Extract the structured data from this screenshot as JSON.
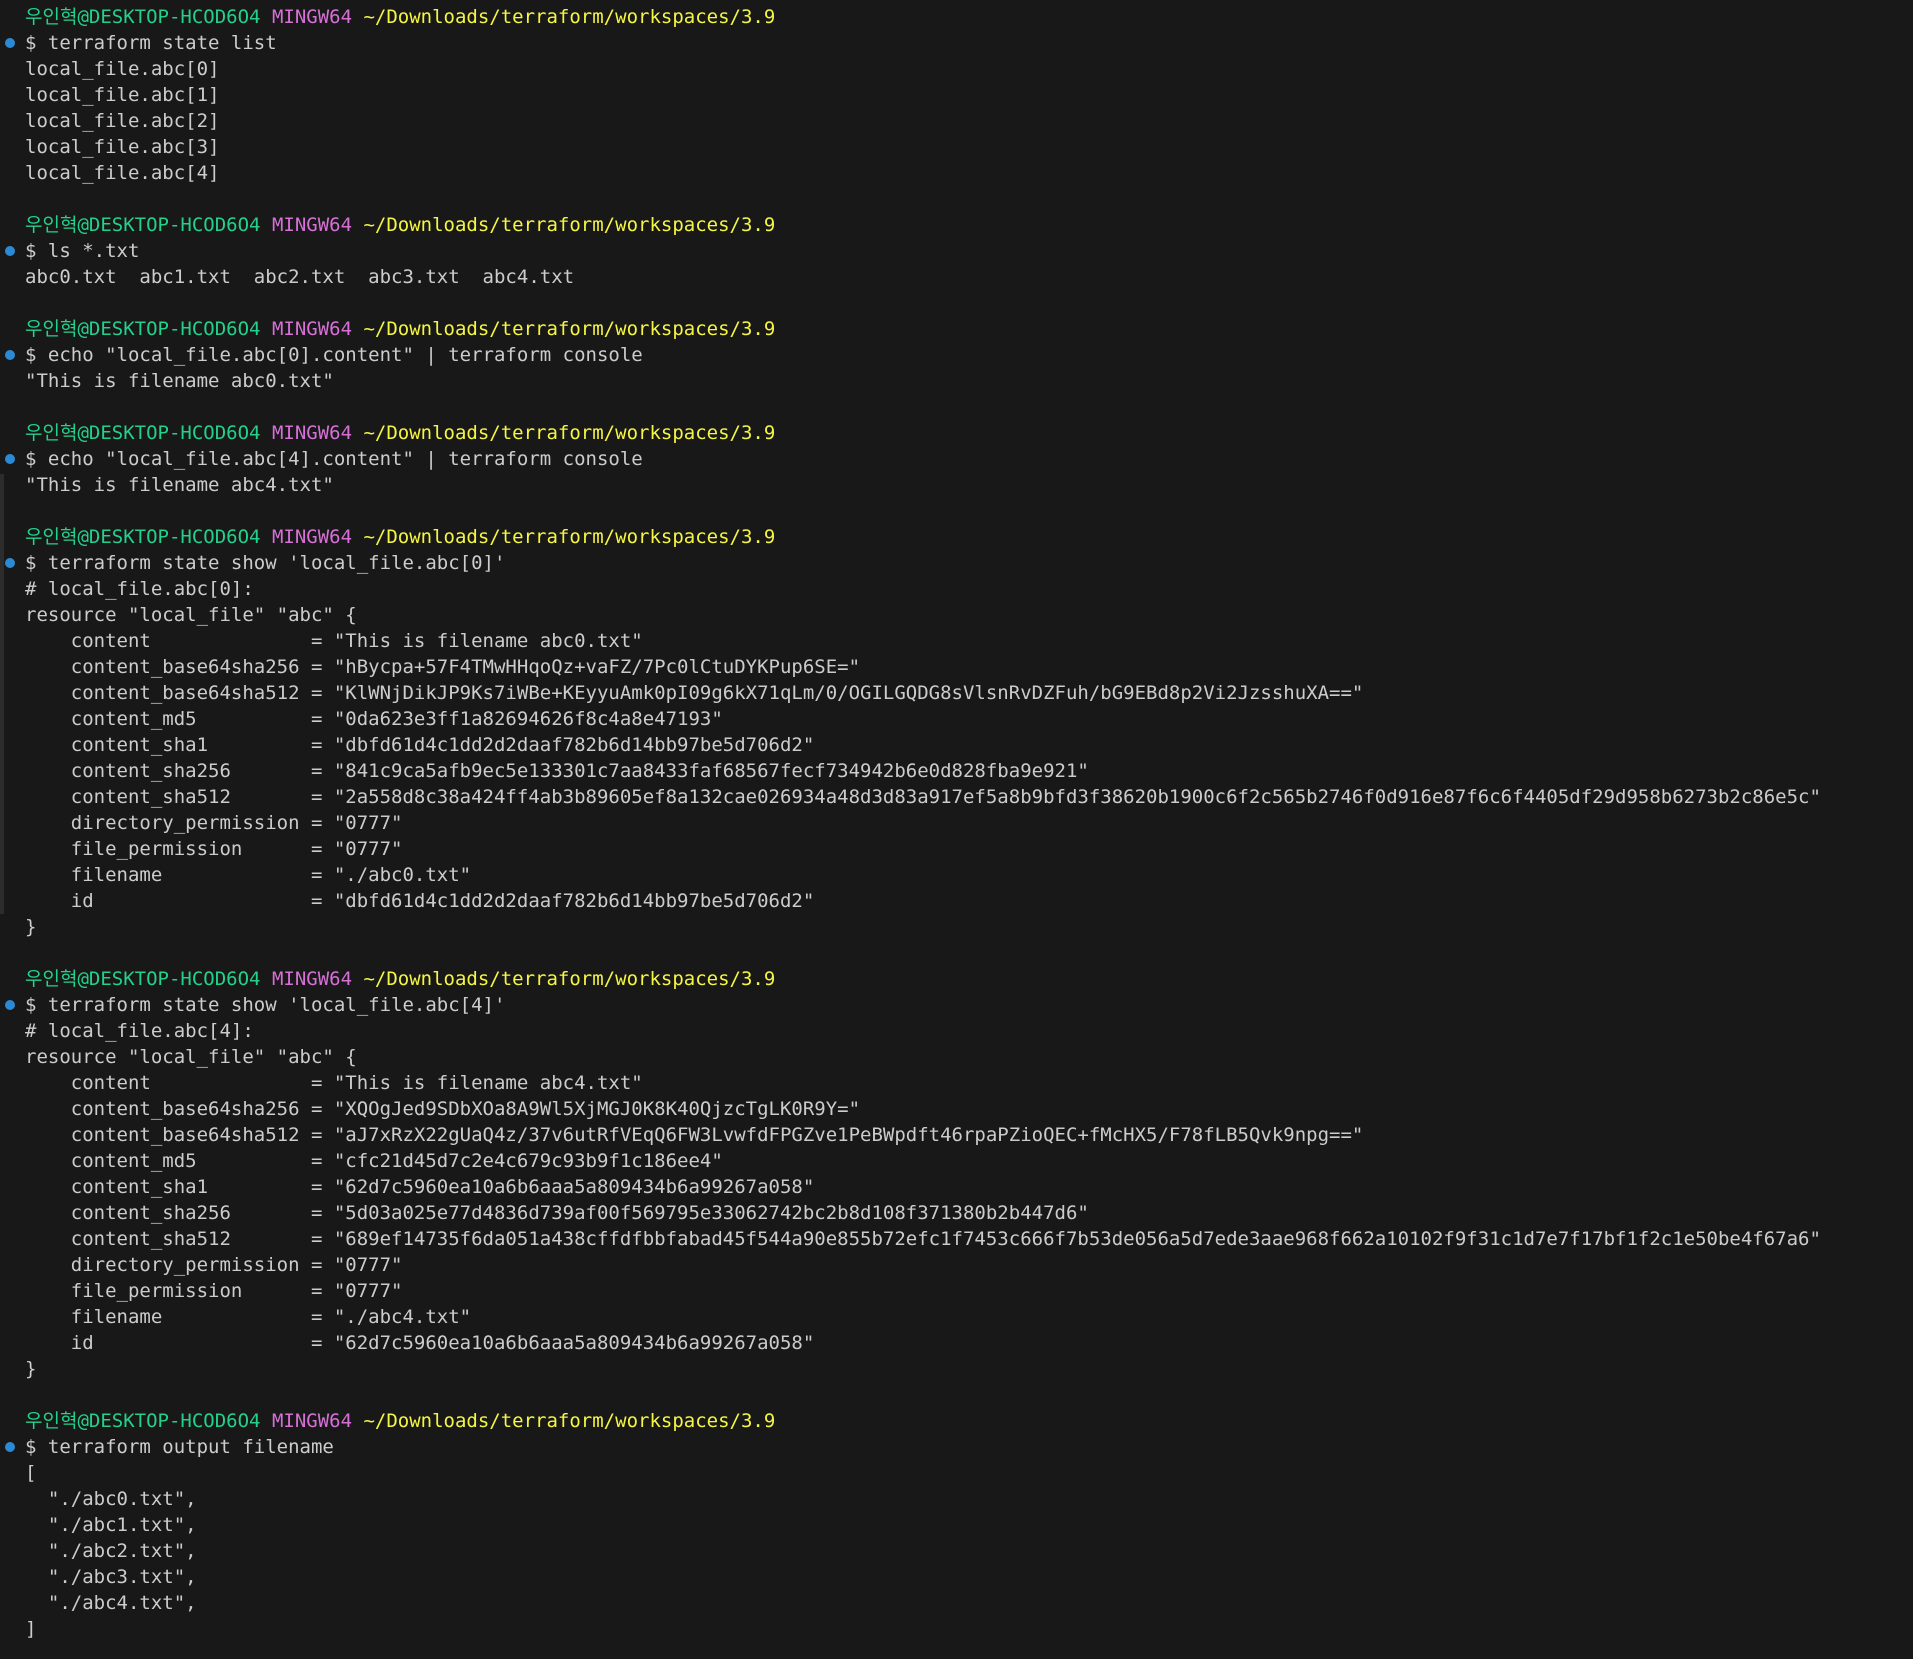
{
  "colors": {
    "background": "#181818",
    "text": "#cccccc",
    "prompt_user": "#23d18b",
    "prompt_system": "#d670d6",
    "prompt_path": "#f5f543",
    "command_marker": "#2b8ad6"
  },
  "prompt": {
    "user": "우인혁",
    "host": "@DESKTOP-HCOD6O4",
    "system": "MINGW64",
    "path": "~/Downloads/terraform/workspaces/3.9"
  },
  "blocks": [
    {
      "command": "$ terraform state list",
      "output": [
        "local_file.abc[0]",
        "local_file.abc[1]",
        "local_file.abc[2]",
        "local_file.abc[3]",
        "local_file.abc[4]"
      ]
    },
    {
      "command": "$ ls *.txt",
      "output": [
        "abc0.txt  abc1.txt  abc2.txt  abc3.txt  abc4.txt"
      ]
    },
    {
      "command": "$ echo \"local_file.abc[0].content\" | terraform console",
      "output": [
        "\"This is filename abc0.txt\""
      ]
    },
    {
      "command": "$ echo \"local_file.abc[4].content\" | terraform console",
      "output": [
        "\"This is filename abc4.txt\""
      ]
    },
    {
      "command": "$ terraform state show 'local_file.abc[0]'",
      "output": [
        "# local_file.abc[0]:",
        "resource \"local_file\" \"abc\" {",
        "    content              = \"This is filename abc0.txt\"",
        "    content_base64sha256 = \"hBycpa+57F4TMwHHqoQz+vaFZ/7Pc0lCtuDYKPup6SE=\"",
        "    content_base64sha512 = \"KlWNjDikJP9Ks7iWBe+KEyyuAmk0pI09g6kX71qLm/0/OGILGQDG8sVlsnRvDZFuh/bG9EBd8p2Vi2JzsshuXA==\"",
        "    content_md5          = \"0da623e3ff1a82694626f8c4a8e47193\"",
        "    content_sha1         = \"dbfd61d4c1dd2d2daaf782b6d14bb97be5d706d2\"",
        "    content_sha256       = \"841c9ca5afb9ec5e133301c7aa8433faf68567fecf734942b6e0d828fba9e921\"",
        "    content_sha512       = \"2a558d8c38a424ff4ab3b89605ef8a132cae026934a48d3d83a917ef5a8b9bfd3f38620b1900c6f2c565b2746f0d916e87f6c6f4405df29d958b6273b2c86e5c\"",
        "    directory_permission = \"0777\"",
        "    file_permission      = \"0777\"",
        "    filename             = \"./abc0.txt\"",
        "    id                   = \"dbfd61d4c1dd2d2daaf782b6d14bb97be5d706d2\"",
        "}"
      ]
    },
    {
      "command": "$ terraform state show 'local_file.abc[4]'",
      "output": [
        "# local_file.abc[4]:",
        "resource \"local_file\" \"abc\" {",
        "    content              = \"This is filename abc4.txt\"",
        "    content_base64sha256 = \"XQOgJed9SDbXOa8A9Wl5XjMGJ0K8K40QjzcTgLK0R9Y=\"",
        "    content_base64sha512 = \"aJ7xRzX22gUaQ4z/37v6utRfVEqQ6FW3LvwfdFPGZve1PeBWpdft46rpaPZioQEC+fMcHX5/F78fLB5Qvk9npg==\"",
        "    content_md5          = \"cfc21d45d7c2e4c679c93b9f1c186ee4\"",
        "    content_sha1         = \"62d7c5960ea10a6b6aaa5a809434b6a99267a058\"",
        "    content_sha256       = \"5d03a025e77d4836d739af00f569795e33062742bc2b8d108f371380b2b447d6\"",
        "    content_sha512       = \"689ef14735f6da051a438cffdfbbfabad45f544a90e855b72efc1f7453c666f7b53de056a5d7ede3aae968f662a10102f9f31c1d7e7f17bf1f2c1e50be4f67a6\"",
        "    directory_permission = \"0777\"",
        "    file_permission      = \"0777\"",
        "    filename             = \"./abc4.txt\"",
        "    id                   = \"62d7c5960ea10a6b6aaa5a809434b6a99267a058\"",
        "}"
      ]
    },
    {
      "command": "$ terraform output filename",
      "output": [
        "[",
        "  \"./abc0.txt\",",
        "  \"./abc1.txt\",",
        "  \"./abc2.txt\",",
        "  \"./abc3.txt\",",
        "  \"./abc4.txt\",",
        "]"
      ]
    }
  ]
}
